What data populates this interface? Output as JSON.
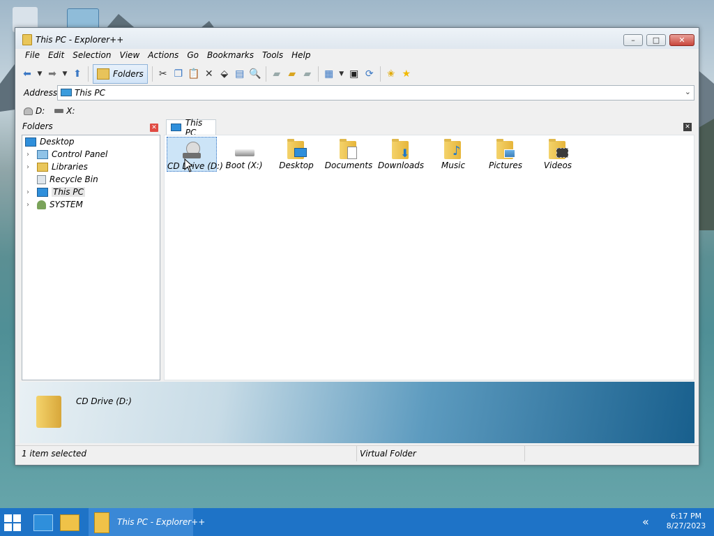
{
  "window": {
    "title": "This PC - Explorer++"
  },
  "menu": [
    "File",
    "Edit",
    "Selection",
    "View",
    "Actions",
    "Go",
    "Bookmarks",
    "Tools",
    "Help"
  ],
  "toolbar": {
    "back_icon": "back-arrow-icon",
    "forward_icon": "forward-arrow-icon",
    "up_icon": "up-arrow-icon",
    "folders_label": "Folders"
  },
  "address": {
    "label": "Address",
    "value": "This PC"
  },
  "drives": [
    {
      "label": "D:"
    },
    {
      "label": "X:"
    }
  ],
  "folders_pane": {
    "title": "Folders",
    "tree": [
      {
        "label": "Desktop"
      },
      {
        "label": "Control Panel"
      },
      {
        "label": "Libraries"
      },
      {
        "label": "Recycle Bin"
      },
      {
        "label": "This PC"
      },
      {
        "label": "SYSTEM"
      }
    ]
  },
  "tab": {
    "label": "This PC"
  },
  "items": [
    {
      "label": "CD Drive (D:)",
      "icon": "cd-drive-icon"
    },
    {
      "label": "Boot (X:)",
      "icon": "hard-drive-icon"
    },
    {
      "label": "Desktop",
      "icon": "desktop-folder-icon"
    },
    {
      "label": "Documents",
      "icon": "documents-folder-icon"
    },
    {
      "label": "Downloads",
      "icon": "downloads-folder-icon"
    },
    {
      "label": "Music",
      "icon": "music-folder-icon"
    },
    {
      "label": "Pictures",
      "icon": "pictures-folder-icon"
    },
    {
      "label": "Videos",
      "icon": "videos-folder-icon"
    }
  ],
  "preview": {
    "title": "CD Drive (D:)"
  },
  "status": {
    "left": "1 item selected",
    "middle": "Virtual Folder"
  },
  "taskbar": {
    "app_label": "This PC - Explorer++",
    "time": "6:17 PM",
    "date": "8/27/2023"
  },
  "colors": {
    "taskbar": "#1e73c7",
    "selection": "#cce4f7",
    "folder": "#e6b53a"
  }
}
